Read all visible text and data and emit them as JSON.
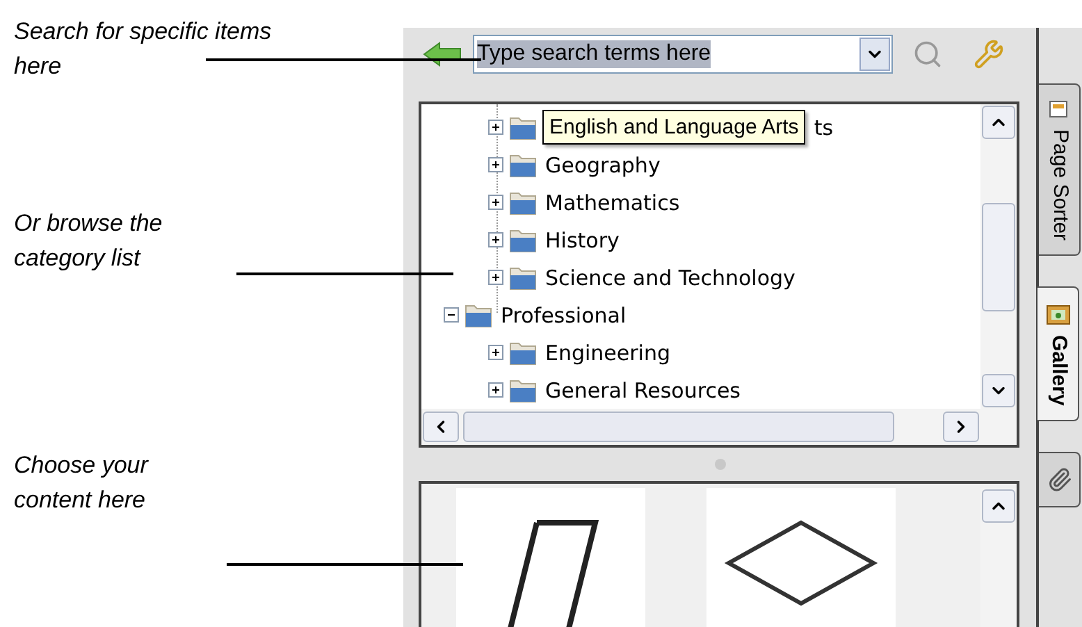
{
  "annotations": [
    {
      "text": "Search for specific items here"
    },
    {
      "text": "Or browse the category list"
    },
    {
      "text": "Choose your content here"
    }
  ],
  "search": {
    "value": "Type search terms here"
  },
  "tree": {
    "items": [
      {
        "children": [
          {
            "label": "ts",
            "expanded": false,
            "tooltip": "English and Language Arts"
          },
          {
            "label": "Geography",
            "expanded": false
          },
          {
            "label": "Mathematics",
            "expanded": false
          },
          {
            "label": "History",
            "expanded": false
          },
          {
            "label": "Science and Technology",
            "expanded": false
          }
        ]
      },
      {
        "label": "Professional",
        "expanded": true,
        "children": [
          {
            "label": "Engineering",
            "expanded": false
          },
          {
            "label": "General Resources",
            "expanded": false
          }
        ]
      }
    ]
  },
  "gallery": {
    "items": [
      {
        "kind": "parallelogram"
      },
      {
        "kind": "diamond"
      }
    ]
  },
  "side_tabs": [
    {
      "label": "Page Sorter",
      "kind": "sorter",
      "selected": false
    },
    {
      "label": "Gallery",
      "kind": "gallery",
      "selected": true
    },
    {
      "kind": "attachments",
      "selected": false
    }
  ]
}
